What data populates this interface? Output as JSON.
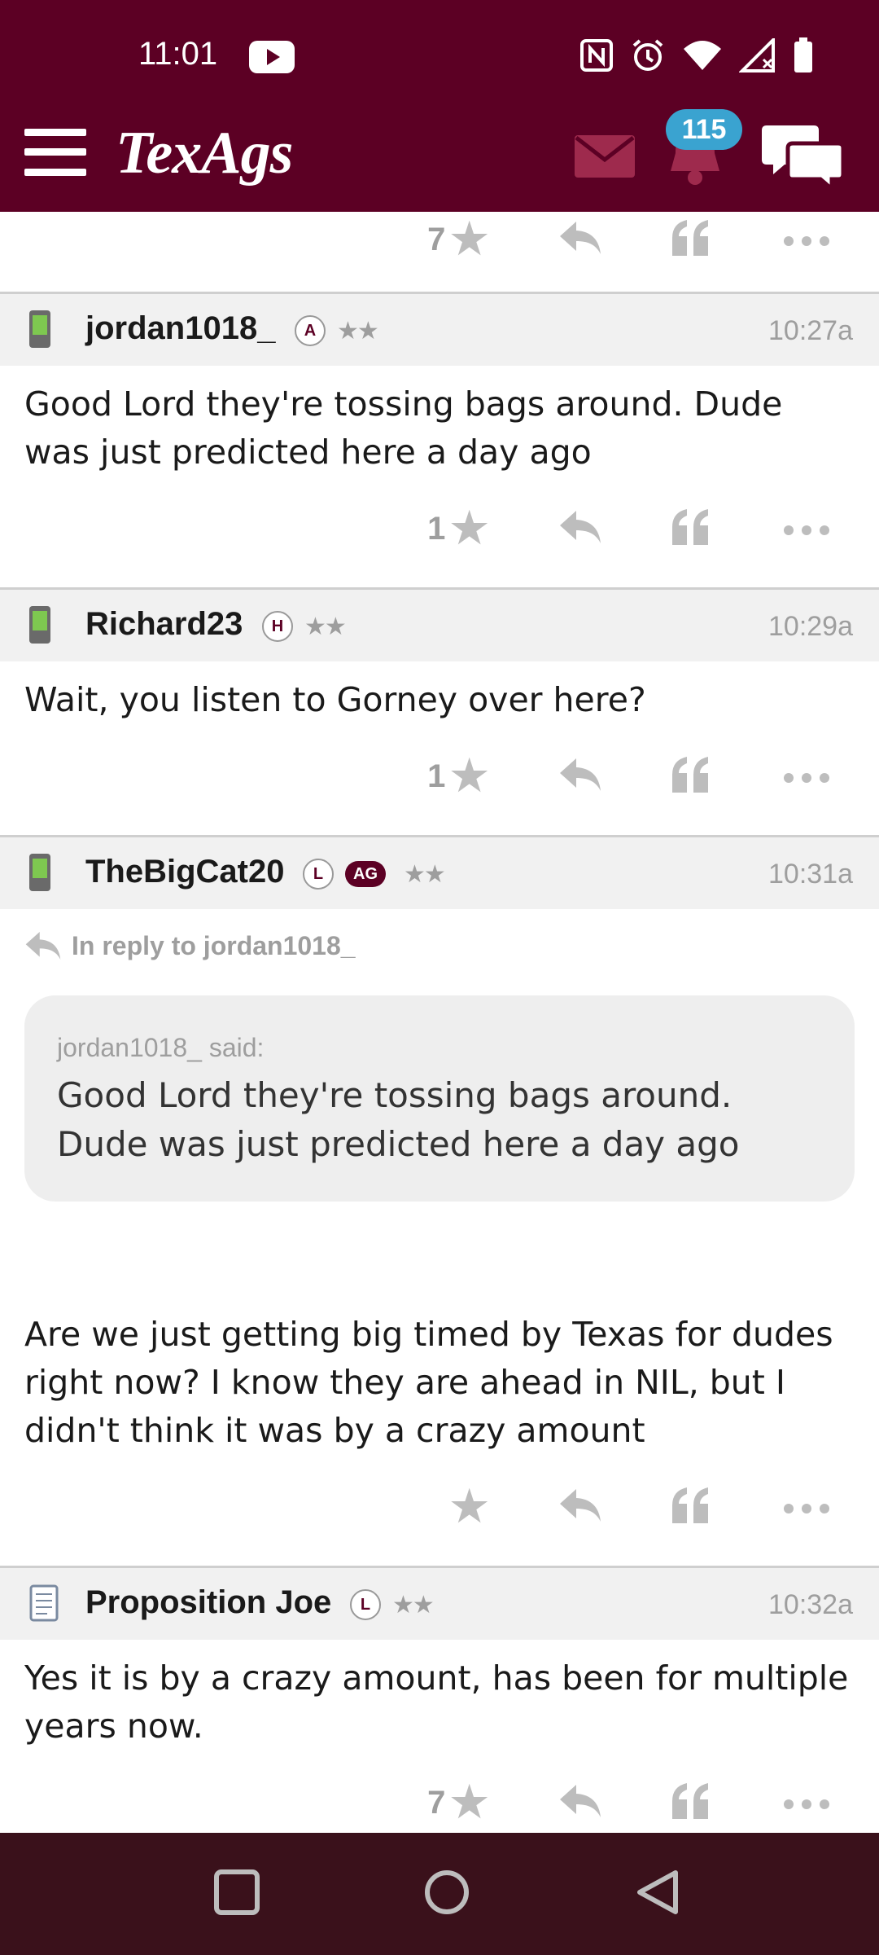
{
  "status_bar": {
    "time": "11:01"
  },
  "app_bar": {
    "logo": "TexAgs",
    "notification_count": "115",
    "icons": [
      "menu-icon",
      "mail-icon",
      "bell-icon",
      "chat-icon"
    ]
  },
  "colors": {
    "brand": "#5c0024",
    "badge_blue": "#3aa3d0",
    "nav_bar": "#3a111b"
  },
  "top_partial_post": {
    "rating": "7"
  },
  "posts": [
    {
      "username": "jordan1018_",
      "badges": [
        "A"
      ],
      "stars": "★★",
      "time": "10:27a",
      "body": "Good Lord they're tossing bags around. Dude was just predicted here a day ago",
      "rating": "1"
    },
    {
      "username": "Richard23",
      "badges": [
        "H"
      ],
      "stars": "★★",
      "time": "10:29a",
      "body": "Wait, you listen to Gorney over here?",
      "rating": "1"
    },
    {
      "username": "TheBigCat20",
      "badges": [
        "L",
        "AG"
      ],
      "stars": "★★",
      "time": "10:31a",
      "reply_to": "In reply to jordan1018_",
      "quote_author": "jordan1018_ said:",
      "quote_text": "Good Lord they're tossing bags around. Dude was just predicted here a day ago",
      "body": "Are we just getting big timed by Texas for dudes right now? I know they are ahead in NIL, but I didn't think it was by a crazy amount",
      "rating": ""
    },
    {
      "username": "Proposition Joe",
      "badges": [
        "L"
      ],
      "stars": "★★",
      "time": "10:32a",
      "body": "Yes it is by a crazy amount, has been for multiple years now.",
      "rating": "7"
    }
  ]
}
